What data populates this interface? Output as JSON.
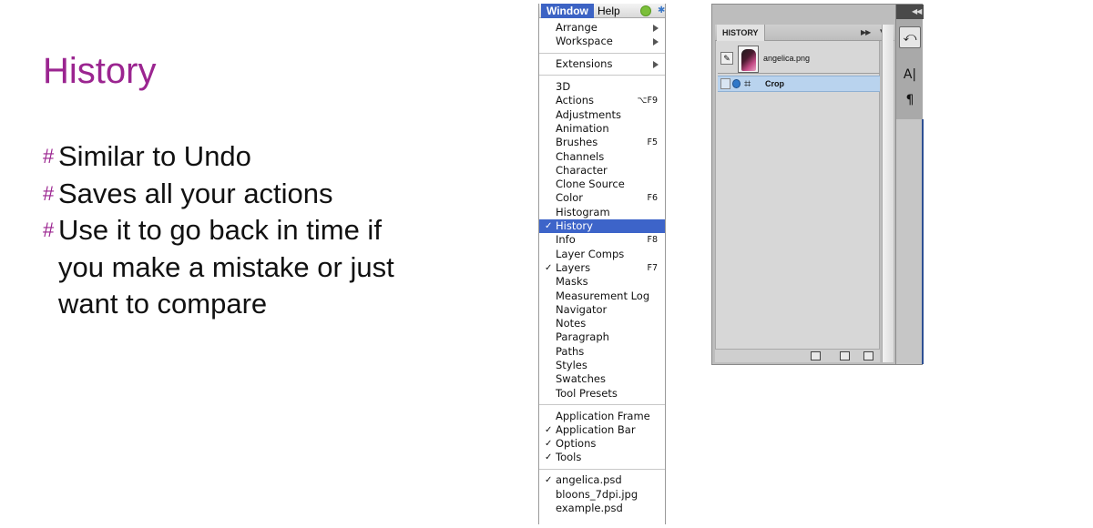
{
  "slide": {
    "title": "History",
    "bullet_marker": "#",
    "bullets": [
      [
        "Similar to Undo"
      ],
      [
        "Saves all your actions"
      ],
      [
        "Use it to go back in time if",
        "you make a mistake or just",
        "want to compare"
      ]
    ]
  },
  "menubar": {
    "window": "Window",
    "help": "Help"
  },
  "window_menu": {
    "items": [
      {
        "label": "Arrange",
        "submenu": true
      },
      {
        "label": "Workspace",
        "submenu": true
      },
      {
        "separator": true
      },
      {
        "label": "Extensions",
        "submenu": true
      },
      {
        "separator": true
      },
      {
        "label": "3D"
      },
      {
        "label": "Actions",
        "shortcut": "⌥F9"
      },
      {
        "label": "Adjustments"
      },
      {
        "label": "Animation"
      },
      {
        "label": "Brushes",
        "shortcut": "F5"
      },
      {
        "label": "Channels"
      },
      {
        "label": "Character"
      },
      {
        "label": "Clone Source"
      },
      {
        "label": "Color",
        "shortcut": "F6"
      },
      {
        "label": "Histogram"
      },
      {
        "label": "History",
        "checked": true,
        "selected": true
      },
      {
        "label": "Info",
        "shortcut": "F8"
      },
      {
        "label": "Layer Comps"
      },
      {
        "label": "Layers",
        "shortcut": "F7",
        "checked": true
      },
      {
        "label": "Masks"
      },
      {
        "label": "Measurement Log"
      },
      {
        "label": "Navigator"
      },
      {
        "label": "Notes"
      },
      {
        "label": "Paragraph"
      },
      {
        "label": "Paths"
      },
      {
        "label": "Styles"
      },
      {
        "label": "Swatches"
      },
      {
        "label": "Tool Presets"
      },
      {
        "separator": true
      },
      {
        "label": "Application Frame"
      },
      {
        "label": "Application Bar",
        "checked": true
      },
      {
        "label": "Options",
        "checked": true
      },
      {
        "label": "Tools",
        "checked": true
      },
      {
        "separator": true
      },
      {
        "label": "angelica.psd",
        "checked": true
      },
      {
        "label": "bloons_7dpi.jpg"
      },
      {
        "label": "example.psd"
      }
    ]
  },
  "history_panel": {
    "tab_label": "HISTORY",
    "snapshot_label": "angelica.png",
    "states": [
      {
        "label": "Crop",
        "selected": true
      }
    ],
    "dock_buttons": [
      "history-dock-icon",
      "character-dock-icon",
      "paragraph-dock-icon"
    ]
  },
  "colors": {
    "title_accent": "#9b2590",
    "menu_selection": "#3d64c9",
    "history_selection": "#b9d3ee"
  }
}
